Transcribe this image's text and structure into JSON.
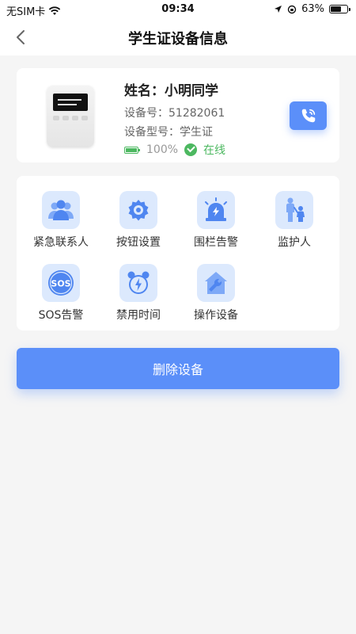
{
  "status_bar": {
    "carrier": "无SIM卡",
    "time": "09:34",
    "battery_pct": "63%"
  },
  "nav": {
    "title": "学生证设备信息",
    "back_icon": "chevron-left-icon"
  },
  "device": {
    "name": "姓名：小明同学",
    "device_no": "设备号：51282061",
    "device_model": "设备型号：学生证",
    "battery": "100%",
    "status": "在线",
    "call_icon": "phone-call-icon",
    "colors": {
      "accent": "#5b8ff9",
      "online": "#4cb860"
    }
  },
  "menu": {
    "items": [
      {
        "label": "紧急联系人",
        "icon": "contacts-icon"
      },
      {
        "label": "按钮设置",
        "icon": "gear-icon"
      },
      {
        "label": "围栏告警",
        "icon": "alarm-light-icon"
      },
      {
        "label": "监护人",
        "icon": "guardian-icon"
      },
      {
        "label": "SOS告警",
        "icon": "sos-icon"
      },
      {
        "label": "禁用时间",
        "icon": "alarm-clock-icon"
      },
      {
        "label": "操作设备",
        "icon": "home-wrench-icon"
      }
    ]
  },
  "actions": {
    "delete_label": "删除设备"
  }
}
